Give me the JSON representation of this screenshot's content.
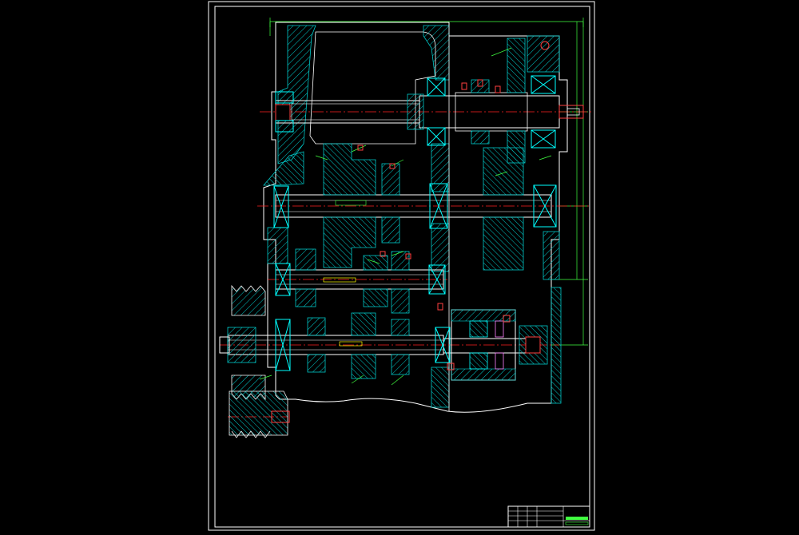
{
  "drawing": {
    "background": "#000000",
    "colors": {
      "frame": "#ffffff",
      "outline": "#ffffff",
      "hatch": "#00c8c8",
      "centerline": "#ff2020",
      "dimension": "#40ff40",
      "leader": "#40ff40",
      "gear": "#ff80ff",
      "bearing": "#00ffff",
      "accent": "#ffff00",
      "label_box": "#ffffff"
    },
    "labels": {
      "shaft_label_2": "",
      "shaft_label_3": ""
    },
    "title_block": {
      "cells": [
        "",
        "",
        "",
        "",
        "",
        ""
      ]
    }
  }
}
